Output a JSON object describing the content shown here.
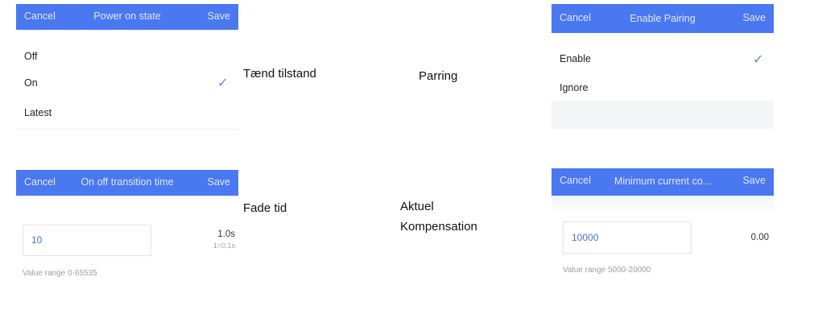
{
  "panels": {
    "power": {
      "cancel": "Cancel",
      "title": "Power on state",
      "save": "Save",
      "options": [
        "Off",
        "On",
        "Latest"
      ],
      "selected": "On",
      "caption": "Tænd tilstand"
    },
    "pairing": {
      "cancel": "Cancel",
      "title": "Enable Pairing",
      "save": "Save",
      "options": [
        "Enable",
        "Ignore"
      ],
      "selected": "Enable",
      "caption": "Parring"
    },
    "transition": {
      "cancel": "Cancel",
      "title": "On off transition time",
      "save": "Save",
      "input_value": "10",
      "display_value": "1.0s",
      "unit_hint": "1=0.1s",
      "range_text": "Value range 0-65535",
      "caption": "Fade tid"
    },
    "compensation": {
      "cancel": "Cancel",
      "title": "Minimum current co...",
      "save": "Save",
      "input_value": "10000",
      "display_value": "0.00",
      "range_text": "Value range 5000-20000",
      "caption_line1": "Aktuel",
      "caption_line2": "Kompensation"
    }
  },
  "icons": {
    "check": "checkmark-icon"
  },
  "colors": {
    "header": "#4a78f0",
    "accent": "#5b86f0"
  }
}
